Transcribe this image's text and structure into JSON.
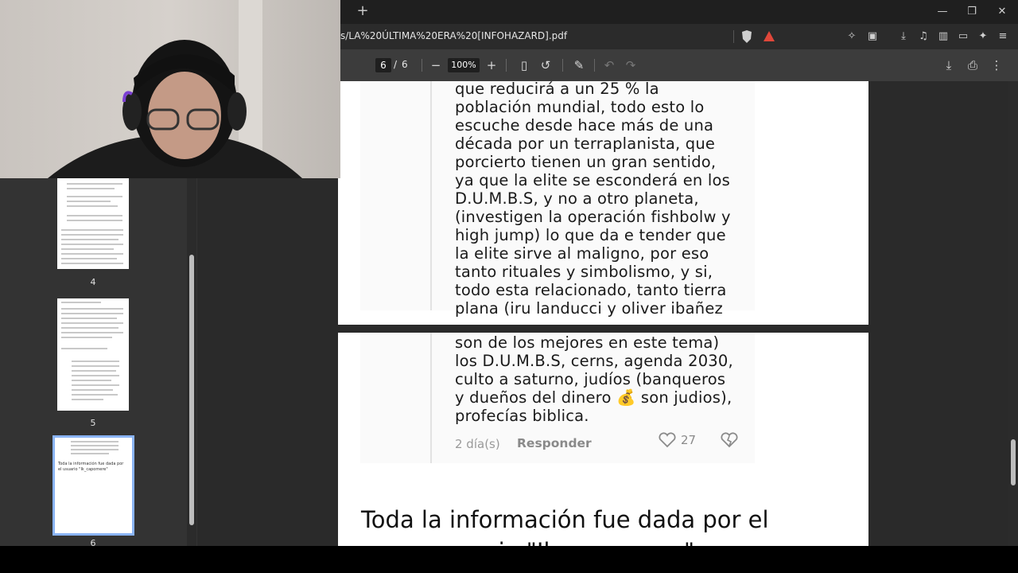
{
  "browser": {
    "new_tab_label": "+",
    "url": "s/LA%20ÚLTIMA%20ERA%20[INFOHAZARD].pdf",
    "window": {
      "minimize": "—",
      "restore": "❐",
      "close": "✕"
    }
  },
  "pdf_toolbar": {
    "current_page": "6",
    "separator": "/",
    "total_pages": "6",
    "zoom": "100%",
    "zoom_out": "−",
    "zoom_in": "+"
  },
  "document": {
    "page5_lines": [
      "que reducirá a un 25 % la",
      "población mundial, todo esto lo",
      "escuche desde hace más de una",
      "década por un terraplanista, que",
      "porcierto tienen un gran sentido,",
      "ya que la elite se esconderá en los",
      "D.U.M.B.S, y no a otro planeta,",
      "(investigen la operación fishbolw y",
      "high jump) lo que da e tender que",
      "la elite sirve al maligno, por eso",
      "tanto rituales y simbolismo, y si,",
      "todo esta relacionado, tanto tierra",
      "plana (iru landucci y oliver ibañez"
    ],
    "page6_lines": [
      "son de los mejores en este tema)",
      "los D.U.M.B.S, cerns, agenda 2030,",
      "culto a saturno, judíos (banqueros",
      "y dueños del dinero 💰 son judios),",
      "profecías biblica."
    ],
    "comment_time": "2 día(s)",
    "reply_label": "Responder",
    "like_count": "27",
    "footer_title": "Toda la información fue dada por el",
    "footer_title_next": "usuario \"Ik_capomere\""
  },
  "thumbnails": [
    {
      "page": "4"
    },
    {
      "page": "5"
    },
    {
      "page": "6",
      "text": "Toda la información fue dada por el usuario \"Ik_capomere\""
    }
  ],
  "colors": {
    "accent": "#8ab4f8",
    "toolbar": "#3c3c3c",
    "viewer_bg": "#2a2a2a"
  }
}
